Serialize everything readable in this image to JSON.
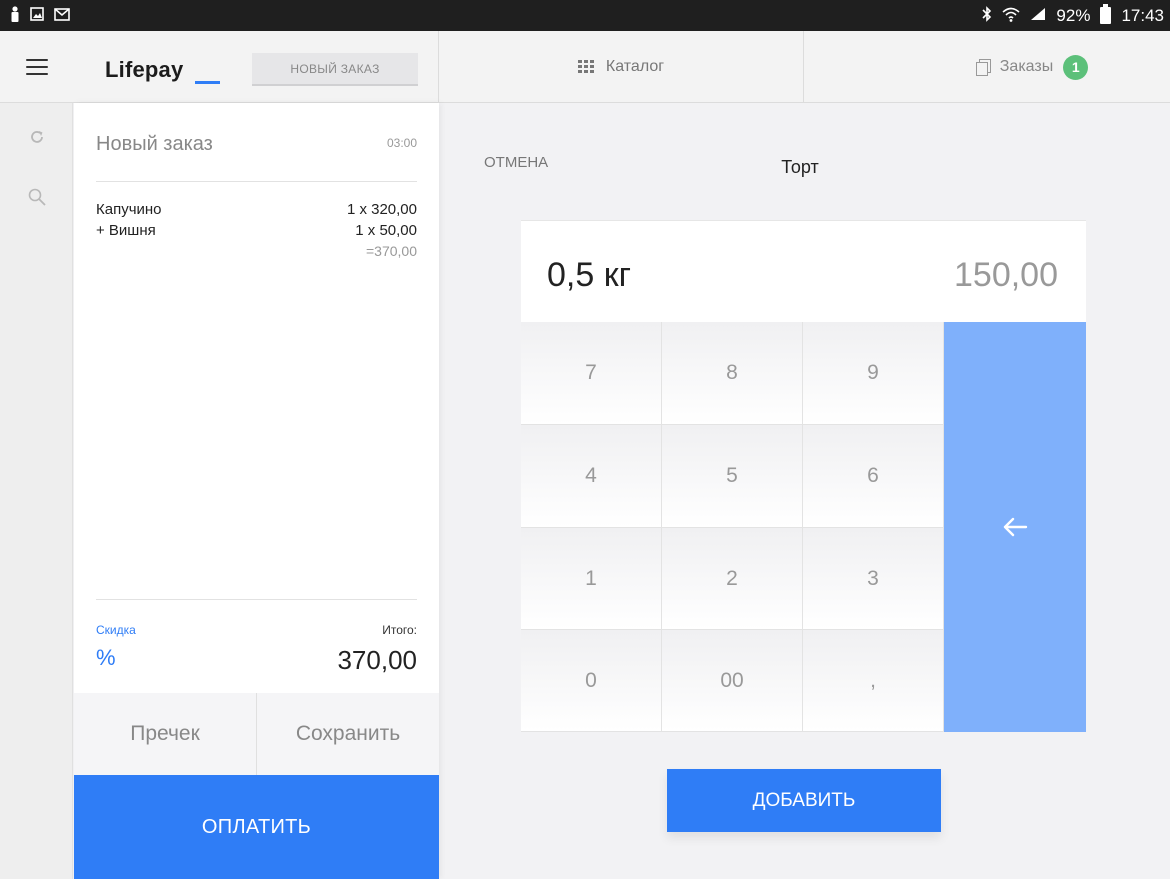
{
  "status_bar": {
    "battery_percent": "92%",
    "time": "17:43"
  },
  "sidebar": {
    "icons": [
      "refresh-icon",
      "search-icon"
    ]
  },
  "header": {
    "logo": "Lifepay",
    "new_order_tab": "НОВЫЙ ЗАКАЗ",
    "catalog_tab": "Каталог",
    "orders_tab": "Заказы",
    "orders_count": "1"
  },
  "order": {
    "title": "Новый заказ",
    "time": "03:00",
    "lines": [
      {
        "name": "Капучино",
        "qty_price": "1 x 320,00"
      },
      {
        "name": "+ Вишня",
        "qty_price": "1 x 50,00"
      }
    ],
    "line_total": "=370,00",
    "discount_label": "Скидка",
    "discount_symbol": "%",
    "total_label": "Итого:",
    "total_value": "370,00",
    "precheck_label": "Пречек",
    "save_label": "Сохранить",
    "pay_label": "ОПЛАТИТЬ"
  },
  "product": {
    "cancel_label": "ОТМЕНА",
    "title": "Торт",
    "quantity": "0,5 кг",
    "price": "150,00",
    "keys": [
      "7",
      "8",
      "9",
      "4",
      "5",
      "6",
      "1",
      "2",
      "3",
      "0",
      "00",
      ","
    ],
    "add_label": "ДОБАВИТЬ"
  },
  "colors": {
    "accent": "#2f7df6",
    "backspace": "#7fb0fb",
    "badge": "#5cc07a"
  }
}
